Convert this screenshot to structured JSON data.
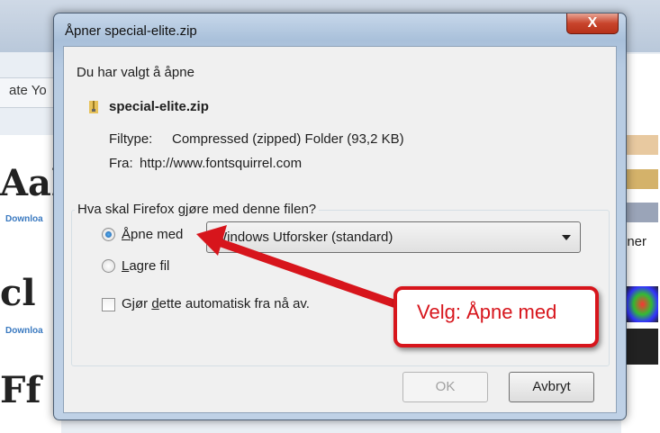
{
  "background": {
    "tab_text": "ate Yo",
    "glyphs": [
      "Aal",
      "cl",
      "Ff"
    ],
    "download_label": "Downloa",
    "right_text": "gner"
  },
  "dialog": {
    "title": "Åpner special-elite.zip",
    "close_glyph": "X",
    "intro": "Du har valgt å åpne",
    "file_name": "special-elite.zip",
    "filetype_label": "Filtype:",
    "filetype_value": "Compressed (zipped) Folder (93,2 KB)",
    "from_label": "Fra:",
    "from_value": "http://www.fontsquirrel.com",
    "question": "Hva skal Firefox gjøre med denne filen?",
    "open_with": {
      "label_key": "Å",
      "label_rest": "pne med",
      "selected": true
    },
    "app_select": "Windows Utforsker (standard)",
    "save_file": {
      "label_key": "L",
      "label_rest": "agre fil",
      "selected": false
    },
    "auto": {
      "label_pre": "Gjør ",
      "label_key": "d",
      "label_rest": "ette automatisk fra nå av.",
      "checked": false
    },
    "ok_label": "OK",
    "cancel_label": "Avbryt"
  },
  "callout": {
    "text": "Velg: Åpne med",
    "color": "#d7151c"
  }
}
